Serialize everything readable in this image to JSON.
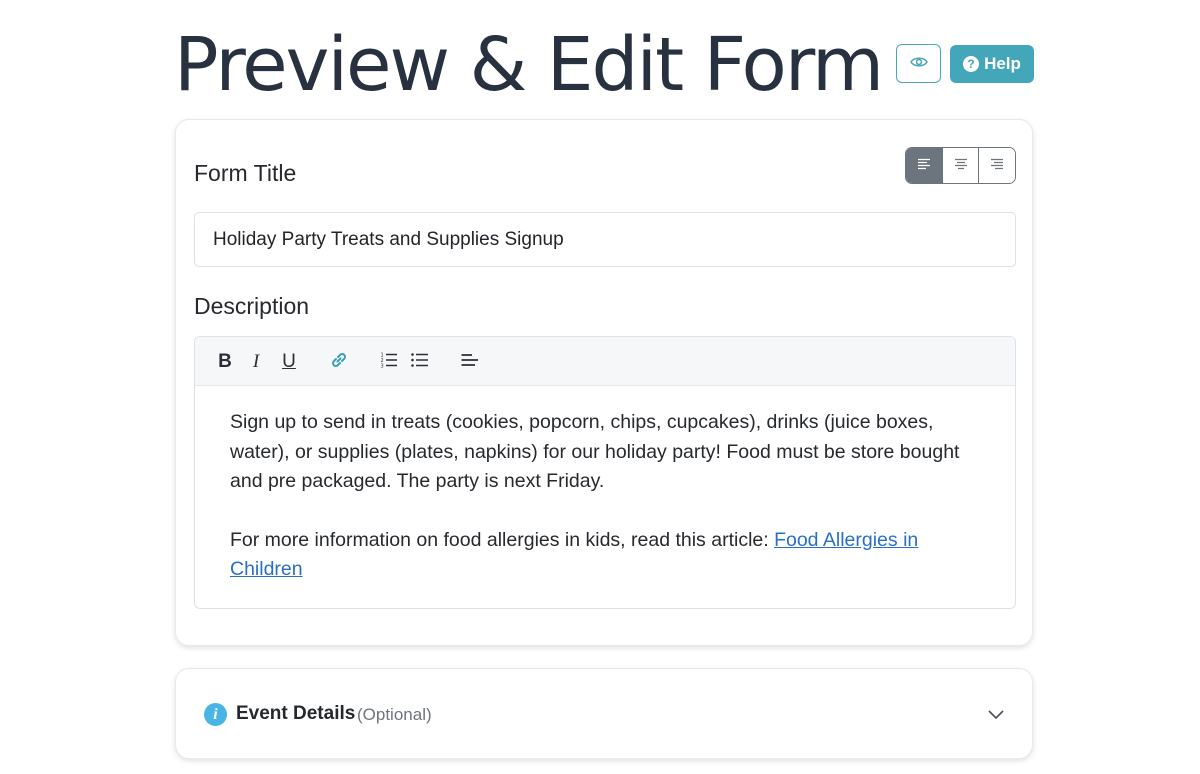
{
  "header": {
    "title": "Preview & Edit Form",
    "preview_icon": "eye-icon",
    "help_label": "Help",
    "help_icon": "question-circle-icon"
  },
  "form": {
    "title_label": "Form Title",
    "title_value": "Holiday Party Treats and Supplies Signup",
    "alignment": {
      "options": [
        "align-left-icon",
        "align-center-icon",
        "align-right-icon"
      ],
      "selected": "left"
    },
    "description_label": "Description",
    "toolbar": {
      "bold": "B",
      "italic": "I",
      "underline": "U",
      "icons": [
        "link-icon",
        "ordered-list-icon",
        "unordered-list-icon",
        "text-align-icon"
      ]
    },
    "description": {
      "paragraph1": "Sign up to send in treats (cookies, popcorn, chips, cupcakes), drinks (juice boxes, water), or supplies (plates, napkins) for our holiday party! Food must be store bought and pre packaged. The party is next Friday.",
      "paragraph2_text": "For more information on food allergies in kids, read this article: ",
      "link_text": "Food Allergies in Children"
    }
  },
  "event_details": {
    "title": "Event Details",
    "optional_label": "(Optional)",
    "icon": "info-icon",
    "expand_icon": "chevron-down-icon"
  },
  "colors": {
    "accent": "#44a6b9",
    "link": "#2870c6",
    "info": "#49b4e6",
    "active_align": "#6c757d"
  }
}
